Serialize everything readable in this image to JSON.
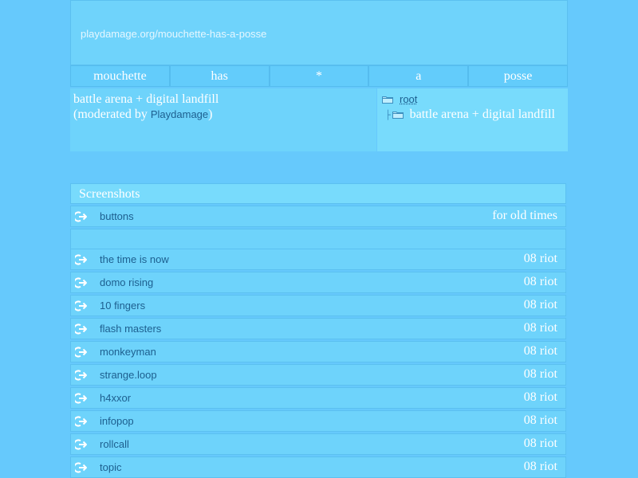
{
  "banner": {
    "url": "playdamage.org/mouchette-has-a-posse"
  },
  "nav": {
    "items": [
      "mouchette",
      "has",
      "*",
      "a",
      "posse"
    ]
  },
  "info": {
    "title": "battle arena + digital landfill",
    "moderated_prefix": "(moderated by ",
    "moderator": "Playdamage",
    "moderated_suffix": ")"
  },
  "tree": {
    "root_label": "root",
    "child_label": "battle arena + digital landfill"
  },
  "section": {
    "title": "Screenshots"
  },
  "rows": [
    {
      "title": "buttons",
      "tag": "for old times"
    },
    {
      "title": "",
      "tag": ""
    },
    {
      "title": "the time is now",
      "tag": "08 riot"
    },
    {
      "title": "domo rising",
      "tag": "08 riot"
    },
    {
      "title": "10 fingers",
      "tag": "08 riot"
    },
    {
      "title": "flash masters",
      "tag": "08 riot"
    },
    {
      "title": "monkeyman",
      "tag": "08 riot"
    },
    {
      "title": "strange.loop",
      "tag": "08 riot"
    },
    {
      "title": "h4xxor",
      "tag": "08 riot"
    },
    {
      "title": "infopop",
      "tag": "08 riot"
    },
    {
      "title": "rollcall",
      "tag": "08 riot"
    },
    {
      "title": "topic",
      "tag": "08 riot"
    }
  ],
  "icons": {
    "row_icon": "arrow-exit-icon",
    "folder_icon": "folder-icon"
  },
  "colors": {
    "background": "#66c9fc",
    "panel": "#6ed3fb",
    "link": "#1d5f8f",
    "text": "#ffffff"
  }
}
